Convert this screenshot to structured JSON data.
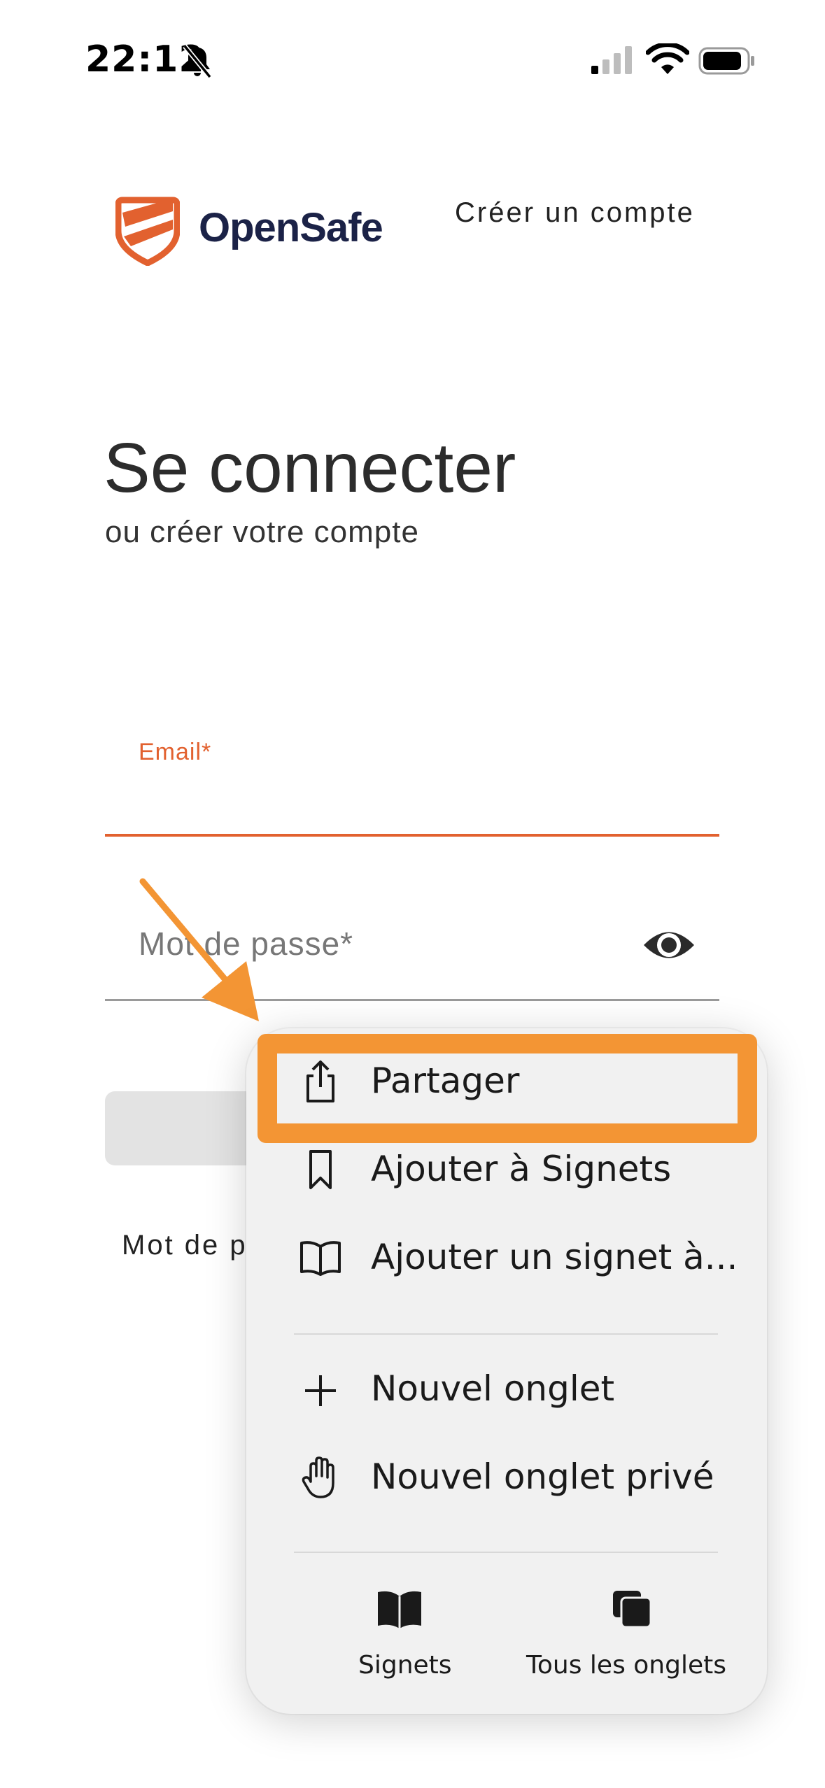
{
  "status_bar": {
    "time": "22:12",
    "icons": [
      "bell-slash-icon",
      "cellular-signal-icon",
      "wifi-icon",
      "battery-icon"
    ]
  },
  "header": {
    "brand": "OpenSafe",
    "create_account": "Créer un compte"
  },
  "main": {
    "title": "Se connecter",
    "subtitle": "ou créer votre compte",
    "email_label": "Email*",
    "password_placeholder": "Mot de passe*",
    "forgot_password_visible": "Mot de p"
  },
  "context_menu": {
    "items": [
      {
        "label": "Partager",
        "icon": "share-icon",
        "highlighted": true
      },
      {
        "label": "Ajouter à Signets",
        "icon": "bookmark-icon"
      },
      {
        "label": "Ajouter un signet à...",
        "icon": "open-book-icon"
      },
      {
        "label": "Nouvel onglet",
        "icon": "plus-icon"
      },
      {
        "label": "Nouvel onglet privé",
        "icon": "hand-icon"
      }
    ],
    "bottom_buttons": [
      {
        "label": "Signets",
        "icon": "book-filled-icon"
      },
      {
        "label": "Tous les onglets",
        "icon": "tabs-icon"
      }
    ]
  },
  "colors": {
    "accent": "#e2612f",
    "brand_text": "#1b2247",
    "highlight": "#f39534",
    "menu_bg": "#f1f1f1"
  }
}
